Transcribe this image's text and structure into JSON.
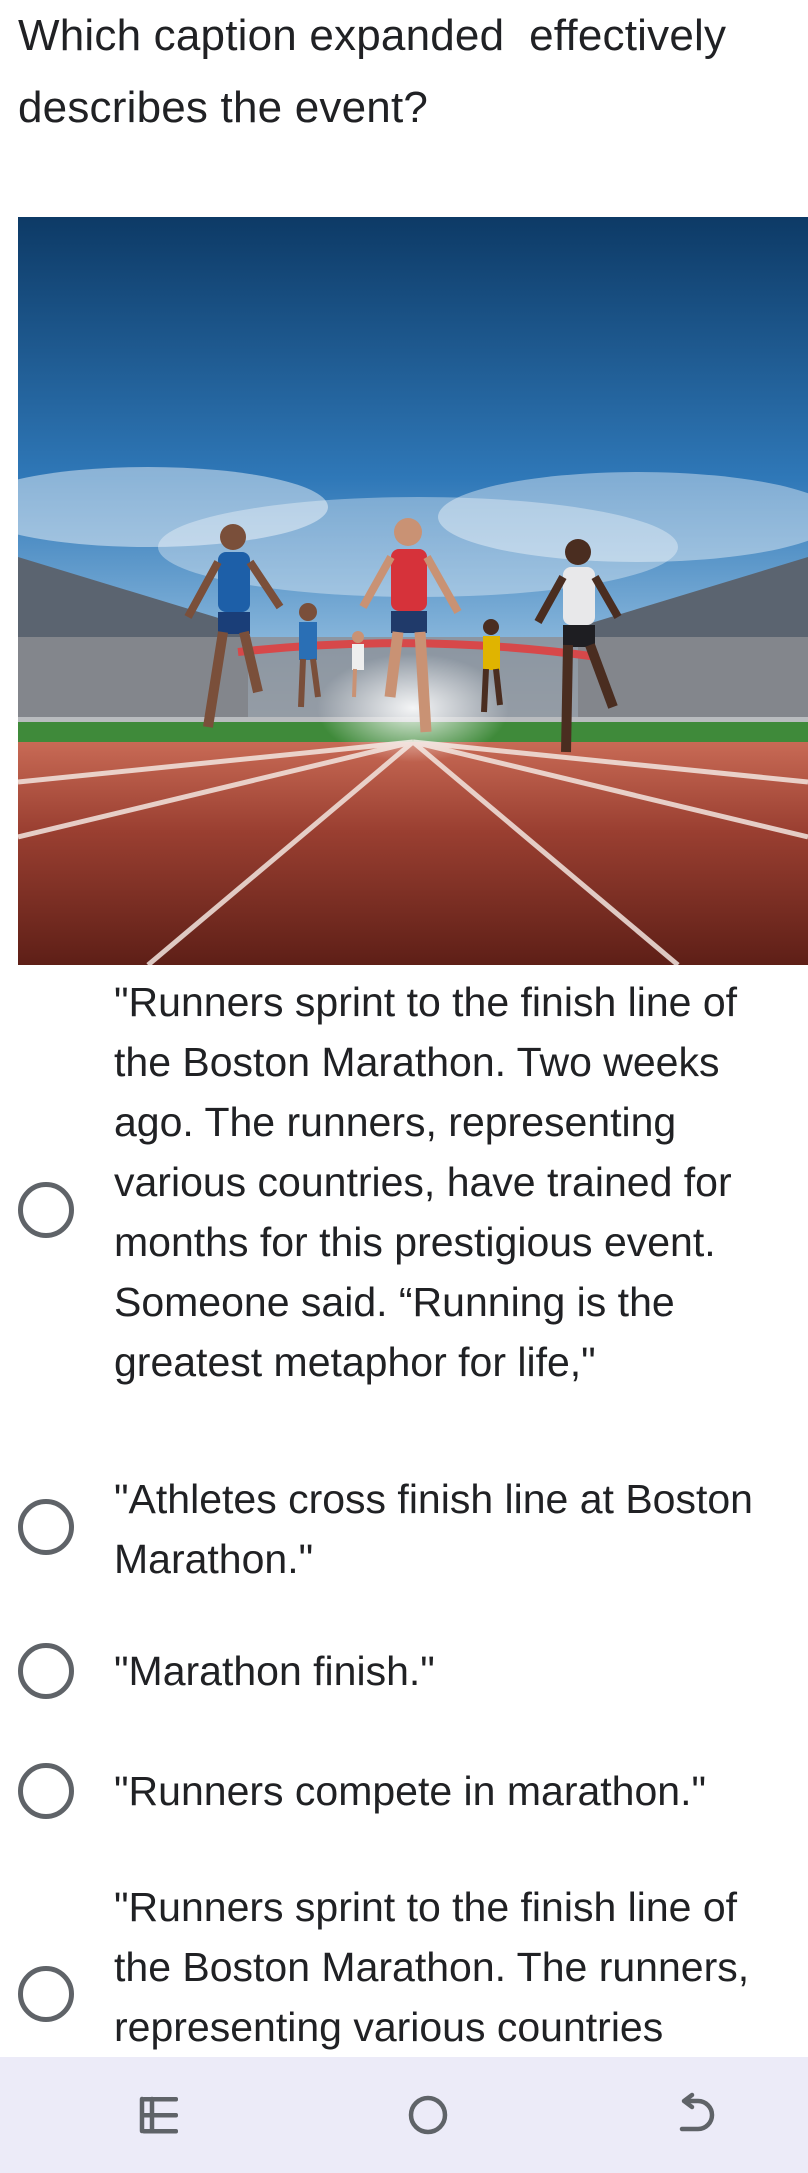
{
  "question": {
    "text": "Which caption expanded  effectively describes the event?"
  },
  "image": {
    "alt_name": "runners-finish-line-photo"
  },
  "options": [
    {
      "text": "\"Runners sprint to the finish line of the Boston Marathon. Two weeks ago. The runners, representing various countries, have trained for months for this prestigious event. Someone said. “Running is the greatest metaphor for life,\"",
      "selected": false
    },
    {
      "text": "\"Athletes cross finish line at Boston Marathon.\"",
      "selected": false
    },
    {
      "text": "\"Marathon finish.\"",
      "selected": false
    },
    {
      "text": "\"Runners compete in marathon.\"",
      "selected": false
    },
    {
      "text": "\"Runners sprint to the finish line of the Boston Marathon. The runners, representing various countries",
      "selected": false
    }
  ],
  "navbar": {
    "recents_icon": "recents-icon",
    "home_icon": "home-icon",
    "back_icon": "back-icon",
    "background": "#ecebf8"
  },
  "colors": {
    "radio_border": "#5f6368",
    "text": "#202124"
  }
}
